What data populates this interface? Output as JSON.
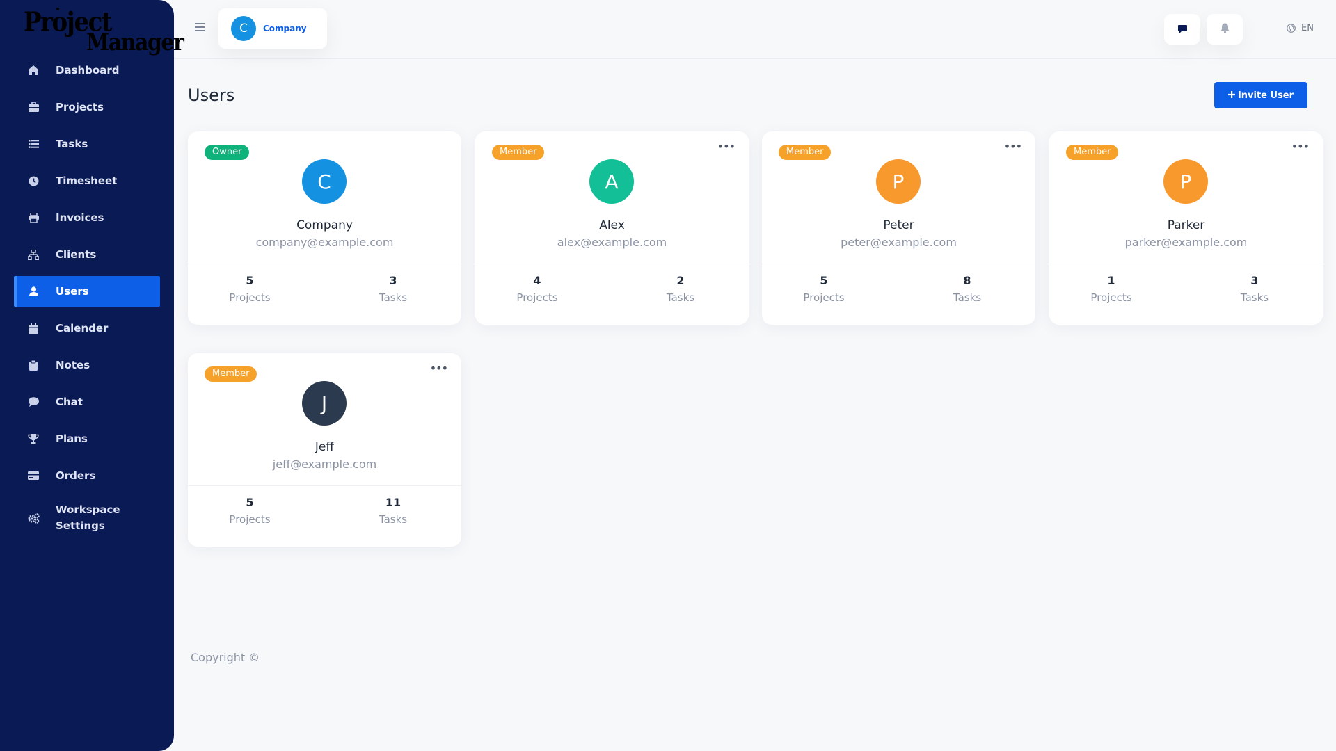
{
  "logo": {
    "line1": "Project",
    "line2": "Manager"
  },
  "sidebar": {
    "items": [
      {
        "label": "Dashboard",
        "icon": "home-icon"
      },
      {
        "label": "Projects",
        "icon": "briefcase-icon"
      },
      {
        "label": "Tasks",
        "icon": "list-icon"
      },
      {
        "label": "Timesheet",
        "icon": "clock-icon"
      },
      {
        "label": "Invoices",
        "icon": "printer-icon"
      },
      {
        "label": "Clients",
        "icon": "sitemap-icon"
      },
      {
        "label": "Users",
        "icon": "user-icon",
        "active": true
      },
      {
        "label": "Calender",
        "icon": "calendar-icon"
      },
      {
        "label": "Notes",
        "icon": "clipboard-icon"
      },
      {
        "label": "Chat",
        "icon": "chat-icon"
      },
      {
        "label": "Plans",
        "icon": "trophy-icon"
      },
      {
        "label": "Orders",
        "icon": "credit-card-icon"
      },
      {
        "label": "Workspace Settings",
        "icon": "cogs-icon"
      }
    ]
  },
  "header": {
    "workspace_initial": "C",
    "workspace_name": "Company",
    "language": "EN"
  },
  "main": {
    "title": "Users",
    "invite_label": "Invite User",
    "stat_labels": {
      "projects": "Projects",
      "tasks": "Tasks"
    },
    "users": [
      {
        "role": "Owner",
        "initial": "C",
        "name": "Company",
        "email": "company@example.com",
        "projects": "5",
        "tasks": "3",
        "avatar_color": "#1491e0"
      },
      {
        "role": "Member",
        "initial": "A",
        "name": "Alex",
        "email": "alex@example.com",
        "projects": "4",
        "tasks": "2",
        "avatar_color": "#12bf96"
      },
      {
        "role": "Member",
        "initial": "P",
        "name": "Peter",
        "email": "peter@example.com",
        "projects": "5",
        "tasks": "8",
        "avatar_color": "#f7992c"
      },
      {
        "role": "Member",
        "initial": "P",
        "name": "Parker",
        "email": "parker@example.com",
        "projects": "1",
        "tasks": "3",
        "avatar_color": "#f7992c"
      },
      {
        "role": "Member",
        "initial": "J",
        "name": "Jeff",
        "email": "jeff@example.com",
        "projects": "5",
        "tasks": "11",
        "avatar_color": "#2b3a4e"
      }
    ]
  },
  "footer": {
    "copyright": "Copyright ©"
  },
  "colors": {
    "sidebar_bg": "#0a1a55",
    "accent": "#0d5fe8",
    "owner_badge": "#10b27c",
    "member_badge": "#f6a22a"
  }
}
